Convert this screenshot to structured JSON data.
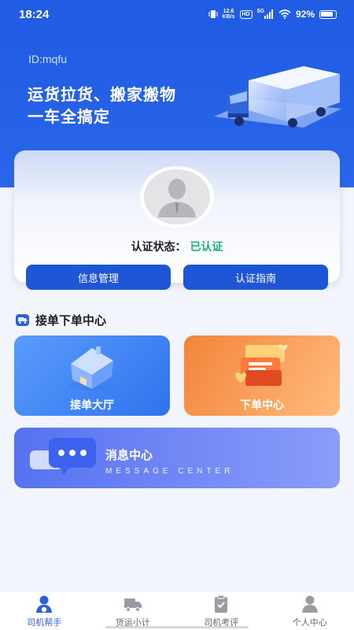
{
  "status_bar": {
    "time": "18:24",
    "speed_value": "12.6",
    "speed_unit": "KB/s",
    "hd": "HD",
    "signal": "5G",
    "battery": "92%"
  },
  "header": {
    "user_id": "ID:mqfu",
    "slogan_line1": "运货拉货、搬家搬物",
    "slogan_line2": "一车全搞定"
  },
  "profile": {
    "cert_label": "认证状态：",
    "cert_value": "已认证",
    "btn_info": "信息管理",
    "btn_guide": "认证指南"
  },
  "section": {
    "title": "接单下单中心"
  },
  "tiles": {
    "hall": "接单大厅",
    "order": "下单中心"
  },
  "message": {
    "title": "消息中心",
    "subtitle": "MESSAGE CENTER"
  },
  "tabs": [
    {
      "label": "司机帮手",
      "icon": "driver-icon"
    },
    {
      "label": "货运小计",
      "icon": "truck-icon"
    },
    {
      "label": "司机考评",
      "icon": "clipboard-icon"
    },
    {
      "label": "个人中心",
      "icon": "person-icon"
    }
  ],
  "colors": {
    "primary": "#1f5be3",
    "button": "#1f56d6",
    "certified": "#1fb27a",
    "orange": "#f3843b",
    "purple": "#5672f0"
  }
}
